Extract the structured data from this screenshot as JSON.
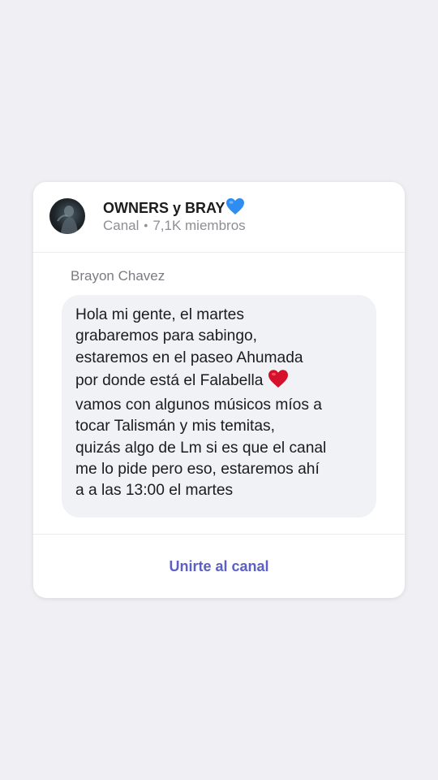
{
  "channel": {
    "name": "OWNERS y BRAY",
    "name_emoji": "blue-heart-icon",
    "type": "Canal",
    "members": "7,1K miembros"
  },
  "post": {
    "sender": "Brayon Chavez",
    "message_before_emoji": "Hola mi gente, el martes\ngrabaremos para sabingo,\nestaremos en el paseo Ahumada\npor donde está el Falabella ",
    "message_emoji": "red-heart-icon",
    "message_after_emoji": "\nvamos con algunos músicos míos a\ntocar Talismán y mis temitas,\nquizás algo de Lm si es que el canal\nme lo pide pero eso, estaremos ahí\na a las 13:00 el martes"
  },
  "actions": {
    "join_label": "Unirte al canal"
  },
  "colors": {
    "background": "#f0eff3",
    "accent": "#5b5fc7",
    "bubble": "#f1f2f6",
    "blue_heart": "#2f8cf0",
    "red_heart": "#d5102a"
  }
}
